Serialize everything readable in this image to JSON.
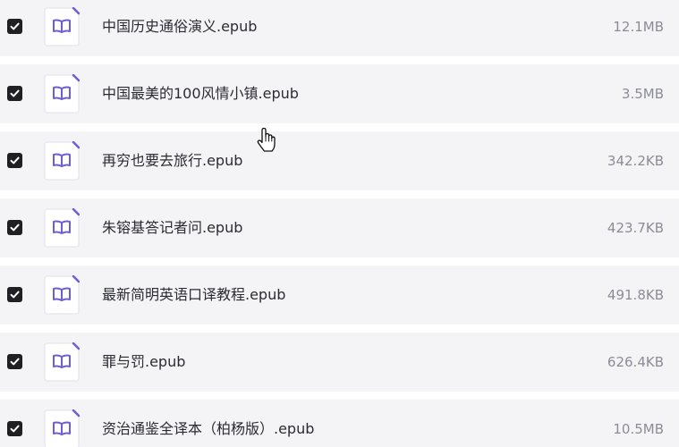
{
  "files": [
    {
      "name": "中国历史通俗演义.epub",
      "size": "12.1MB",
      "checked": true
    },
    {
      "name": "中国最美的100风情小镇.epub",
      "size": "3.5MB",
      "checked": true
    },
    {
      "name": "再穷也要去旅行.epub",
      "size": "342.2KB",
      "checked": true
    },
    {
      "name": "朱镕基答记者问.epub",
      "size": "423.7KB",
      "checked": true
    },
    {
      "name": "最新简明英语口译教程.epub",
      "size": "491.8KB",
      "checked": true
    },
    {
      "name": "罪与罚.epub",
      "size": "626.4KB",
      "checked": true
    },
    {
      "name": "资治通鉴全译本（柏杨版）.epub",
      "size": "10.5MB",
      "checked": true
    }
  ],
  "icons": {
    "checkbox": "checkbox-checked-icon",
    "file": "book-file-icon",
    "cursor": "hand-pointer-cursor"
  },
  "colors": {
    "row_background": "#f4f4f7",
    "checkbox": "#1f1f24",
    "accent": "#6c5fd6",
    "text": "#2b2b33",
    "size_text": "#8c8c96"
  }
}
